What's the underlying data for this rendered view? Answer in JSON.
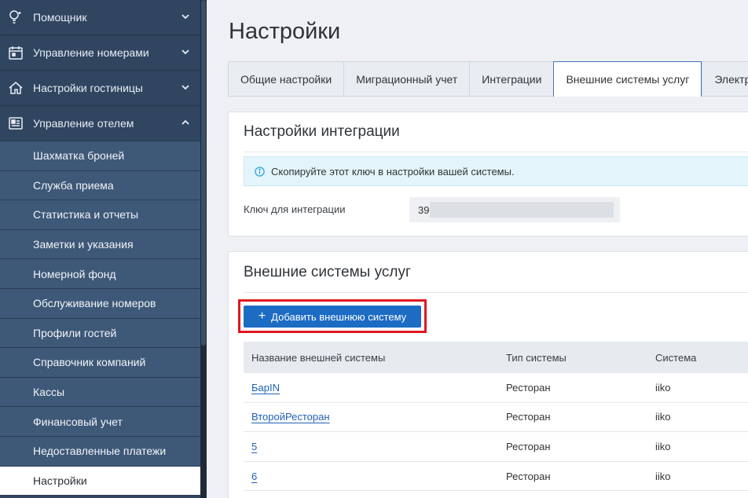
{
  "sidebar": {
    "menu": [
      {
        "label": "Помощник",
        "icon": "lightbulb-icon",
        "expanded": false
      },
      {
        "label": "Управление номерами",
        "icon": "calendar-icon",
        "expanded": false
      },
      {
        "label": "Настройки гостиницы",
        "icon": "house-icon",
        "expanded": false
      },
      {
        "label": "Управление отелем",
        "icon": "dashboard-icon",
        "expanded": true
      }
    ],
    "subitems": [
      "Шахматка броней",
      "Служба приема",
      "Статистика и отчеты",
      "Заметки и указания",
      "Номерной фонд",
      "Обслуживание номеров",
      "Профили гостей",
      "Справочник компаний",
      "Кассы",
      "Финансовый учет",
      "Недоставленные платежи",
      "Настройки"
    ],
    "active_subitem": "Настройки"
  },
  "page": {
    "title": "Настройки"
  },
  "tabs": [
    {
      "label": "Общие настройки",
      "active": false
    },
    {
      "label": "Миграционный учет",
      "active": false
    },
    {
      "label": "Интеграции",
      "active": false
    },
    {
      "label": "Внешние системы услуг",
      "active": true
    },
    {
      "label": "Электро",
      "active": false
    }
  ],
  "integration": {
    "title": "Настройки интеграции",
    "info": "Скопируйте этот ключ в настройки вашей системы.",
    "key_label": "Ключ для интеграции",
    "key_value": "39"
  },
  "external": {
    "title": "Внешние системы услуг",
    "add_button": "Добавить внешнюю систему",
    "columns": [
      "Название внешней системы",
      "Тип системы",
      "Система"
    ],
    "rows": [
      {
        "name": "БарIN",
        "type": "Ресторан",
        "system": "iiko"
      },
      {
        "name": "ВторойРесторан",
        "type": "Ресторан",
        "system": "iiko"
      },
      {
        "name": "5",
        "type": "Ресторан",
        "system": "iiko"
      },
      {
        "name": "6",
        "type": "Ресторан",
        "system": "iiko"
      }
    ]
  },
  "colors": {
    "sidebar_bg": "#2f4560",
    "submenu_bg": "#3e5878",
    "accent": "#1c6cc4",
    "highlight": "#e0171f",
    "info_bg": "#e3f4fb"
  }
}
